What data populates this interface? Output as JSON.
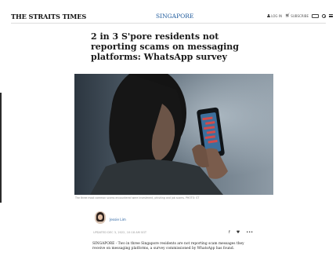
{
  "header": {
    "masthead": "THE STRAITS TIMES",
    "section": "SINGAPORE",
    "login_label": "LOG IN",
    "subscribe_label": "SUBSCRIBE"
  },
  "article": {
    "headline": "2 in 3 S'pore residents not reporting scams on messaging platforms: WhatsApp survey",
    "image_caption": "The three most common scams encountered were investment, phishing and job scams. PHOTO: ST",
    "author": "Jessie Lim",
    "updated": "UPDATED DEC 3, 2022, 10:18 AM SGT",
    "share_facebook": "f",
    "share_twitter": "♥",
    "share_more": "•••",
    "body": "SINGAPORE - Two in three Singapore residents are not reporting scam messages they receive on messaging platforms, a survey commissioned by WhatsApp has found."
  },
  "icons": {
    "user": "user-icon",
    "cart": "cart-icon",
    "epaper": "epaper-icon",
    "search": "search-icon",
    "menu": "hamburger-menu-icon"
  },
  "colors": {
    "accent": "#1e5a9c"
  }
}
